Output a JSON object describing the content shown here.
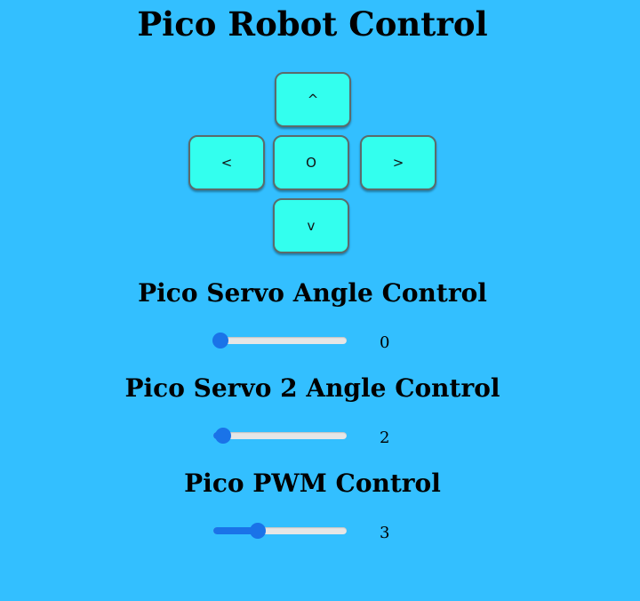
{
  "page": {
    "title": "Pico Robot Control"
  },
  "dpad": {
    "up": "^",
    "left": "<",
    "stop": "O",
    "right": ">",
    "down": "v"
  },
  "servo1": {
    "title": "Pico Servo Angle Control",
    "value": "0",
    "fraction": 0.05
  },
  "servo2": {
    "title": "Pico Servo 2 Angle Control",
    "value": "2",
    "fraction": 0.07
  },
  "pwm": {
    "title": "Pico PWM Control",
    "value": "3",
    "fraction": 0.33
  },
  "colors": {
    "background": "#33bfff",
    "button": "#33ffee",
    "slider_accent": "#1a73e8"
  }
}
